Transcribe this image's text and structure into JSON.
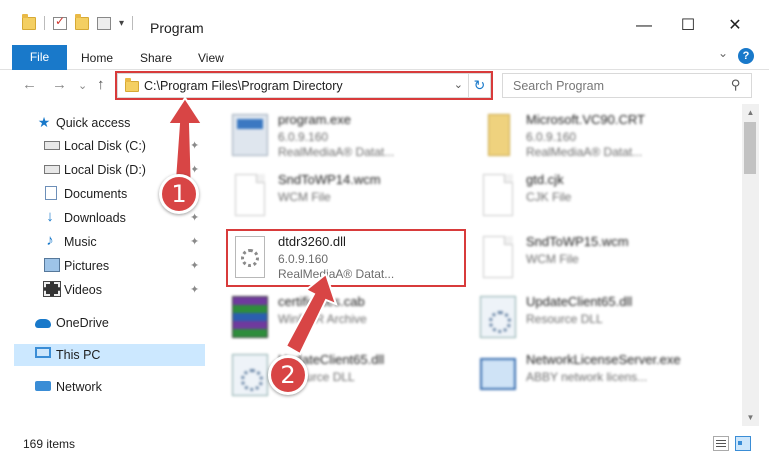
{
  "window": {
    "title": "Program",
    "minimize": "—",
    "maximize": "☐",
    "close": "✕"
  },
  "ribbon": {
    "tabs": [
      "File",
      "Home",
      "Share",
      "View"
    ],
    "expand": "⌄",
    "help": "?"
  },
  "address": {
    "back": "←",
    "forward": "→",
    "recent": "⌄",
    "up": "↑",
    "path": "C:\\Program Files\\Program Directory",
    "dropdown": "⌄",
    "refresh": "↻"
  },
  "search": {
    "placeholder": "Search Program",
    "icon": "⚲"
  },
  "sidebar": {
    "items": [
      {
        "label": "Quick access",
        "icon": "star-icon"
      },
      {
        "label": "Local Disk (C:)",
        "icon": "disk-icon",
        "pinned": true
      },
      {
        "label": "Local Disk (D:)",
        "icon": "disk-icon",
        "pinned": true
      },
      {
        "label": "Documents",
        "icon": "documents-icon",
        "pinned": true
      },
      {
        "label": "Downloads",
        "icon": "downloads-icon",
        "pinned": true
      },
      {
        "label": "Music",
        "icon": "music-icon",
        "pinned": true
      },
      {
        "label": "Pictures",
        "icon": "pictures-icon",
        "pinned": true
      },
      {
        "label": "Videos",
        "icon": "videos-icon",
        "pinned": true
      },
      {
        "label": "OneDrive",
        "icon": "cloud-icon"
      },
      {
        "label": "This PC",
        "icon": "computer-icon",
        "selected": true
      },
      {
        "label": "Network",
        "icon": "network-icon"
      }
    ],
    "pin_glyph": "📌"
  },
  "files": [
    {
      "name": "program.exe",
      "line2": "6.0.9.160",
      "line3": "RealMediaA® Datat...",
      "icon": "exe-icon"
    },
    {
      "name": "Microsoft.VC90.CRT",
      "line2": "6.0.9.160",
      "line3": "RealMediaA® Datat...",
      "icon": "folder-icon"
    },
    {
      "name": "SndToWP14.wcm",
      "line2": "WCM File",
      "line3": "",
      "icon": "page-icon"
    },
    {
      "name": "gtd.cjk",
      "line2": "CJK File",
      "line3": "",
      "icon": "page-icon"
    },
    {
      "name": "dtdr3260.dll",
      "line2": "6.0.9.160",
      "line3": "RealMediaA® Datat...",
      "icon": "gear-file-icon"
    },
    {
      "name": "SndToWP15.wcm",
      "line2": "WCM File",
      "line3": "",
      "icon": "page-icon"
    },
    {
      "name": "certificates.cab",
      "line2": "WinRAR Archive",
      "line3": "",
      "icon": "archive-icon"
    },
    {
      "name": "UpdateClient65.dll",
      "line2": "Resource DLL",
      "line3": "",
      "icon": "dll-icon"
    },
    {
      "name": "UpdateClient65.dll",
      "line2": "Resource DLL",
      "line3": "",
      "icon": "dll-icon"
    },
    {
      "name": "NetworkLicenseServer.exe",
      "line2": "ABBY network licens...",
      "line3": "",
      "icon": "monitor-icon"
    }
  ],
  "status": {
    "count": "169 items"
  },
  "callouts": [
    "1",
    "2"
  ],
  "colors": {
    "accent": "#1979ca",
    "highlight": "#d83b3b",
    "selected": "#cce8ff"
  }
}
